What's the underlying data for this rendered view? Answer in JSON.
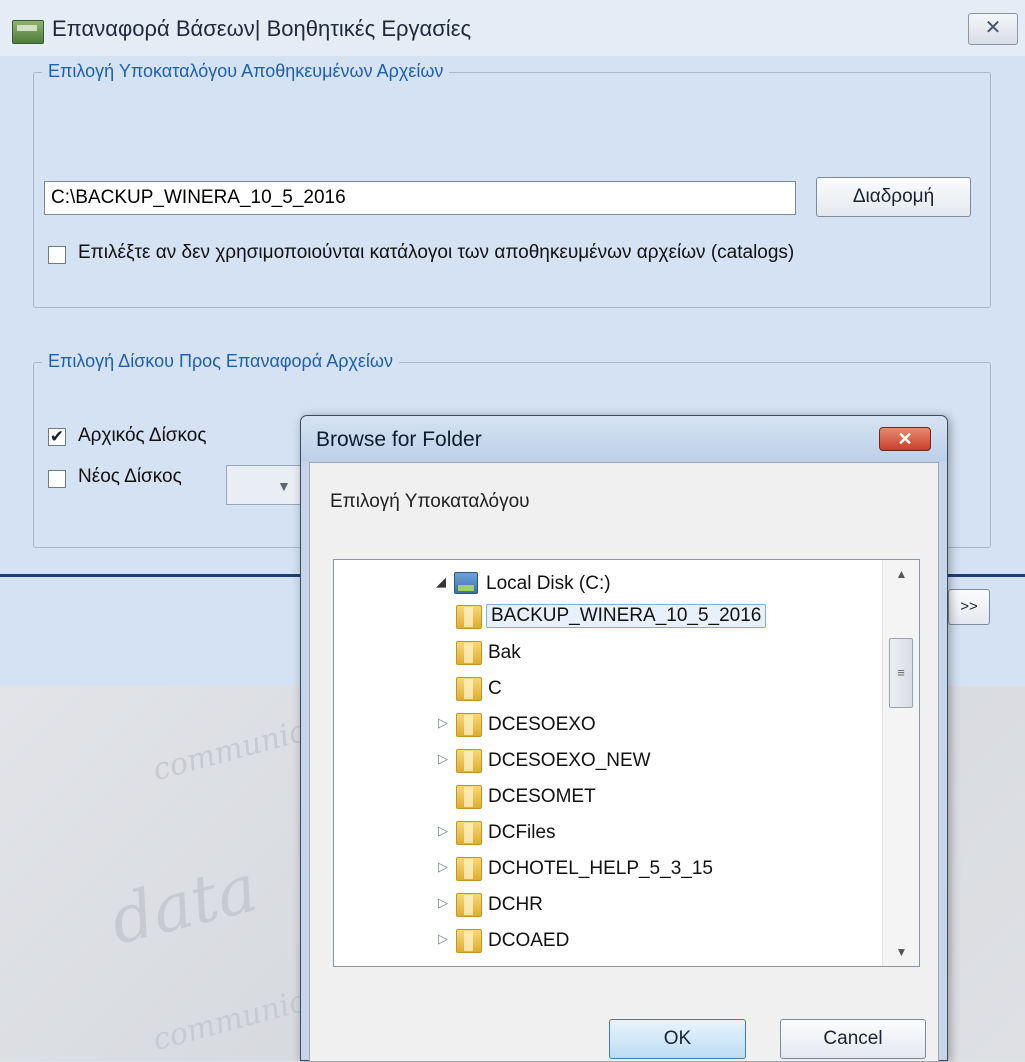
{
  "window": {
    "title": "Επαναφορά Βάσεων| Βοηθητικές Εργασίες",
    "close_glyph": "✕"
  },
  "backup_group": {
    "legend": "Επιλογή Υποκαταλόγου Αποθηκευμένων Αρχείων",
    "path_value": "C:\\BACKUP_WINERA_10_5_2016",
    "browse_label": "Διαδρομή",
    "no_catalogs_label": "Επιλέξτε αν δεν χρησιμοποιούνται κατάλογοι των αποθηκευμένων αρχείων (catalogs)",
    "no_catalogs_checked": false
  },
  "disk_group": {
    "legend": "Επιλογή Δίσκου Προς Επαναφορά Αρχείων",
    "original_disk_label": "Αρχικός Δίσκος",
    "original_disk_checked": true,
    "new_disk_label": "Νέος Δίσκος",
    "new_disk_checked": false
  },
  "next_label": ">>",
  "dialog": {
    "title": "Browse for Folder",
    "close_glyph": "✕",
    "description": "Επιλογή Υποκαταλόγου",
    "ok_label": "OK",
    "cancel_label": "Cancel",
    "drive_label": "Local Disk (C:)",
    "folders": [
      {
        "name": "BACKUP_WINERA_10_5_2016",
        "expandable": false,
        "selected": true
      },
      {
        "name": "Bak",
        "expandable": false,
        "selected": false
      },
      {
        "name": "C",
        "expandable": false,
        "selected": false
      },
      {
        "name": "DCESOEXO",
        "expandable": true,
        "selected": false
      },
      {
        "name": "DCESOEXO_NEW",
        "expandable": true,
        "selected": false
      },
      {
        "name": "DCESOMET",
        "expandable": false,
        "selected": false
      },
      {
        "name": "DCFiles",
        "expandable": true,
        "selected": false
      },
      {
        "name": "DCHOTEL_HELP_5_3_15",
        "expandable": true,
        "selected": false
      },
      {
        "name": "DCHR",
        "expandable": true,
        "selected": false
      },
      {
        "name": "DCOAED",
        "expandable": true,
        "selected": false
      }
    ]
  },
  "colors": {
    "legend_text": "#1f5fae",
    "client_bg": "#d4e2f4",
    "separator": "#1f3e77",
    "selection_border": "#84acdd"
  }
}
